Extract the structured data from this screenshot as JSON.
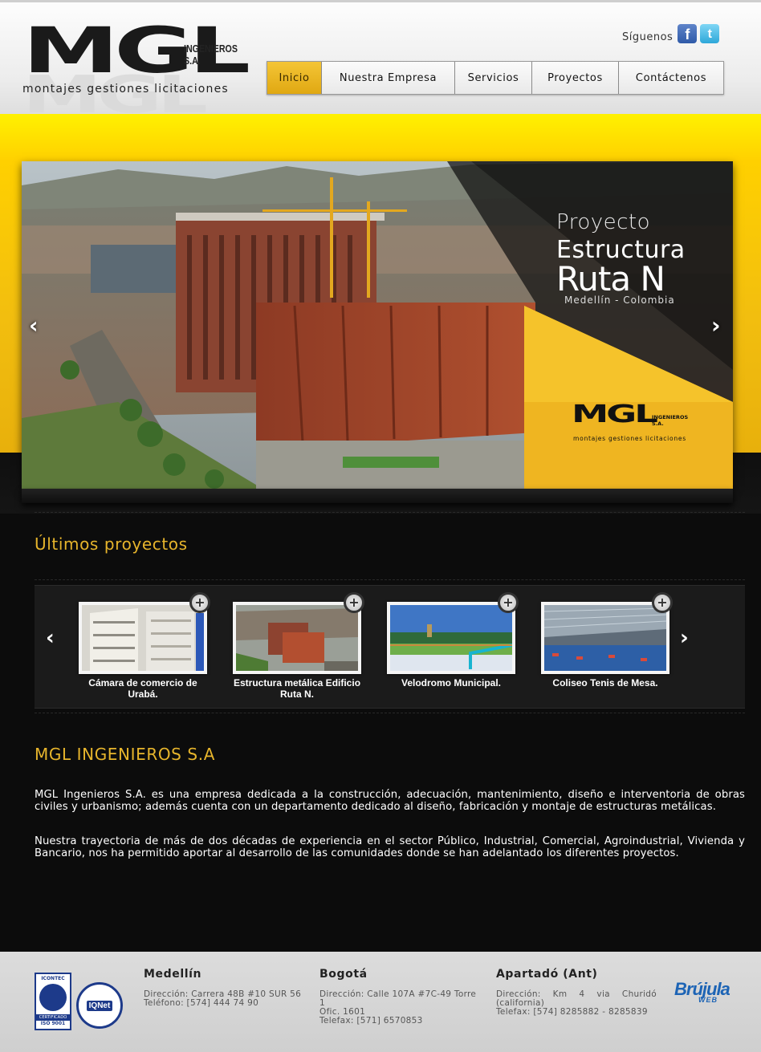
{
  "header": {
    "logo_text": "MGL",
    "logo_company": "INGENIEROS S.A.",
    "logo_tagline": "montajes gestiones licitaciones",
    "social_label": "Síguenos",
    "social": [
      {
        "icon": "facebook-icon",
        "glyph": "f"
      },
      {
        "icon": "twitter-icon",
        "glyph": "t"
      }
    ]
  },
  "nav": {
    "items": [
      "Inicio",
      "Nuestra Empresa",
      "Servicios",
      "Proyectos",
      "Contáctenos"
    ],
    "active": "Inicio"
  },
  "slider": {
    "line1": "Proyecto",
    "line2": "Estructura",
    "line3": "Ruta N",
    "location": "Medellín - Colombia",
    "logo_text": "MGL",
    "logo_company": "INGENIEROS S.A.",
    "logo_tagline": "montajes gestiones licitaciones",
    "prev": "‹",
    "next": "›"
  },
  "projects": {
    "title": "Últimos proyectos",
    "prev": "‹",
    "next": "›",
    "plus": "+",
    "items": [
      {
        "caption": "Cámara de comercio de Urabá."
      },
      {
        "caption": "Estructura metálica Edificio Ruta N."
      },
      {
        "caption": "Velodromo Municipal."
      },
      {
        "caption": "Coliseo Tenis de Mesa."
      }
    ]
  },
  "about": {
    "title": "MGL INGENIEROS S.A",
    "p1": "MGL Ingenieros S.A. es una empresa dedicada a la construcción, adecuación, mantenimiento, diseño e interventoria de obras civiles y urbanismo; además cuenta con un departamento dedicado al diseño, fabricación y montaje de estructuras metálicas.",
    "p2": "Nuestra trayectoria de más de dos décadas de experiencia en el sector Público, Industrial, Comercial, Agroindustrial, Vivienda y Bancario, nos ha permitido aportar al desarrollo de las comunidades donde se han adelantado los diferentes proyectos."
  },
  "footer": {
    "cert_top": "ICONTEC",
    "cert_mid": "CERTIFICADO",
    "cert_iso": "ISO 9001",
    "iqnet": "IQNet",
    "offices": [
      {
        "name": "Medellín",
        "lines": [
          "Dirección: Carrera 48B #10 SUR 56",
          "Teléfono: [574] 444 74 90"
        ]
      },
      {
        "name": "Bogotá",
        "lines": [
          "Dirección: Calle 107A #7C-49 Torre 1",
          "Ofic. 1601",
          "Telefax: [571] 6570853"
        ]
      },
      {
        "name": "Apartadó (Ant)",
        "lines": [
          "Dirección: Km 4 via Churidó",
          "(california)",
          "Telefax: [574] 8285882 - 8285839"
        ]
      }
    ],
    "credit": "Brújula",
    "credit_sub": "WEB"
  },
  "colors": {
    "accent": "#e7b52c",
    "yellow": "#f2be0f",
    "background": "#0c0c0c"
  }
}
